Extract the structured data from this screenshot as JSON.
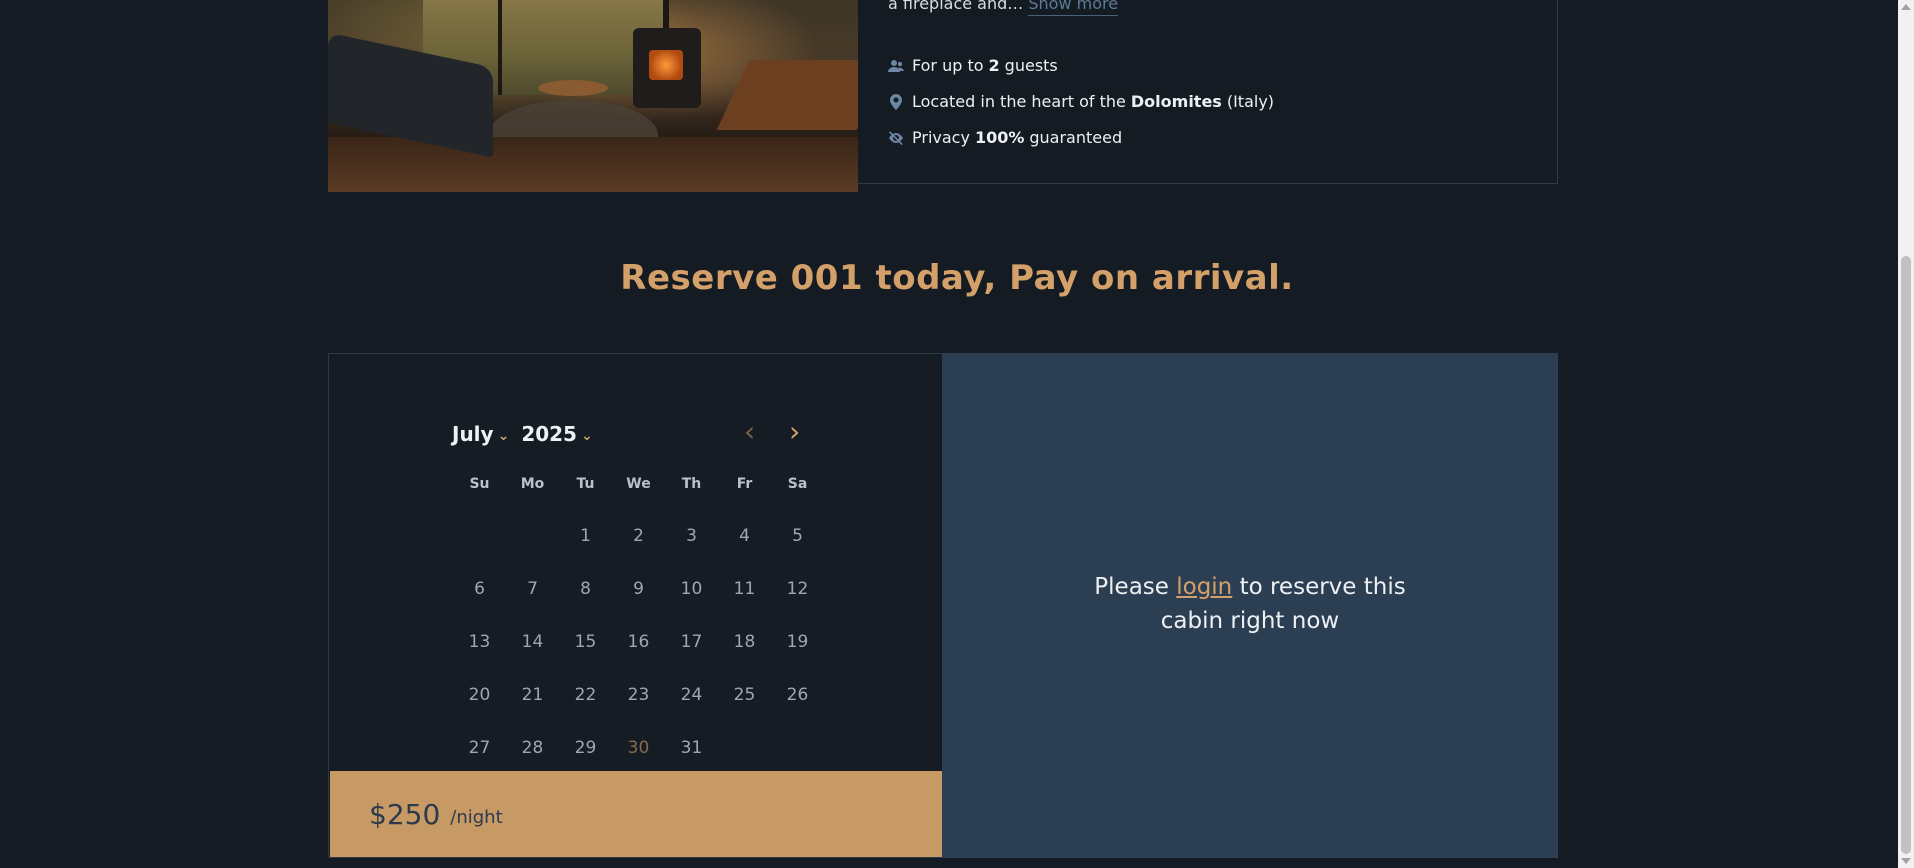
{
  "cabin": {
    "description_tail": "a fireplace and…",
    "show_more": "Show more",
    "features": [
      {
        "icon": "guests-icon",
        "pre": "For up to",
        "bold": "2",
        "post": "guests"
      },
      {
        "icon": "location-pin-icon",
        "pre": "Located in the heart of the",
        "bold": "Dolomites",
        "post": "(Italy)"
      },
      {
        "icon": "eye-slash-icon",
        "pre": "Privacy",
        "bold": "100%",
        "post": "guaranteed"
      }
    ]
  },
  "reserve": {
    "title": "Reserve 001 today, Pay on arrival."
  },
  "calendar": {
    "month": "July",
    "year": "2025",
    "weekdays": [
      "Su",
      "Mo",
      "Tu",
      "We",
      "Th",
      "Fr",
      "Sa"
    ],
    "leading_blanks": 2,
    "days": [
      "1",
      "2",
      "3",
      "4",
      "5",
      "6",
      "7",
      "8",
      "9",
      "10",
      "11",
      "12",
      "13",
      "14",
      "15",
      "16",
      "17",
      "18",
      "19",
      "20",
      "21",
      "22",
      "23",
      "24",
      "25",
      "26",
      "27",
      "28",
      "29",
      "30",
      "31"
    ],
    "today": "30"
  },
  "pricing": {
    "price": "$250",
    "unit": "/night"
  },
  "login_prompt": {
    "before": "Please",
    "link": "login",
    "after": "to reserve this cabin right now"
  },
  "colors": {
    "background": "#141b22",
    "accent": "#d4a06a",
    "price_bar": "#c79a65",
    "login_panel": "#2c3e51"
  }
}
